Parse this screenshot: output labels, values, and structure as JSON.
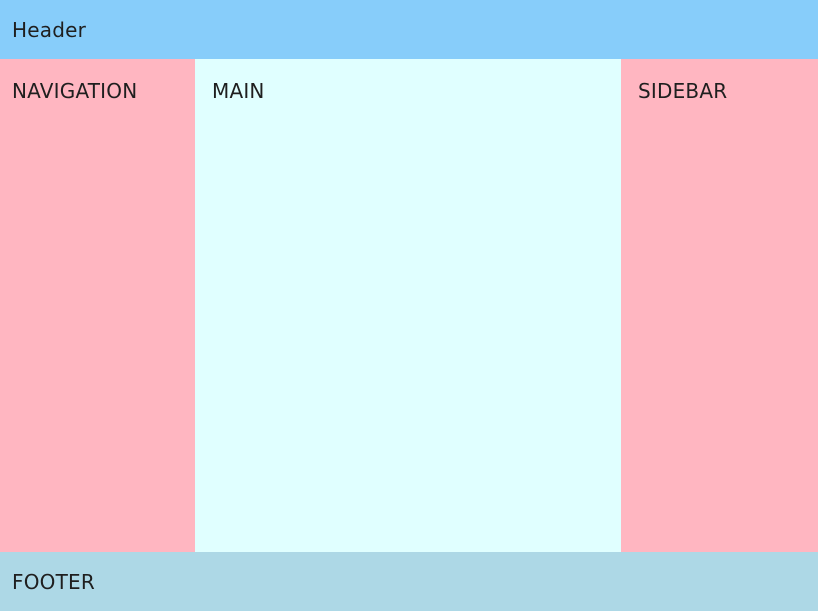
{
  "header": {
    "label": "Header"
  },
  "navigation": {
    "label": "NAVIGATION"
  },
  "main": {
    "label": "MAIN"
  },
  "sidebar": {
    "label": "SIDEBAR"
  },
  "footer": {
    "label": "FOOTER"
  },
  "colors": {
    "header": "#87cdfa",
    "navigation": "#ffb6c1",
    "main": "#e0ffff",
    "sidebar": "#ffb6c1",
    "footer": "#add8e6"
  }
}
